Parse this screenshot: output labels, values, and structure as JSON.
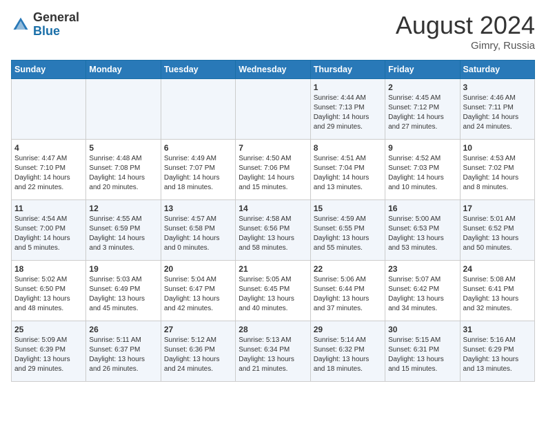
{
  "header": {
    "logo_general": "General",
    "logo_blue": "Blue",
    "month_year": "August 2024",
    "location": "Gimry, Russia"
  },
  "weekdays": [
    "Sunday",
    "Monday",
    "Tuesday",
    "Wednesday",
    "Thursday",
    "Friday",
    "Saturday"
  ],
  "weeks": [
    [
      {
        "day": "",
        "info": ""
      },
      {
        "day": "",
        "info": ""
      },
      {
        "day": "",
        "info": ""
      },
      {
        "day": "",
        "info": ""
      },
      {
        "day": "1",
        "info": "Sunrise: 4:44 AM\nSunset: 7:13 PM\nDaylight: 14 hours\nand 29 minutes."
      },
      {
        "day": "2",
        "info": "Sunrise: 4:45 AM\nSunset: 7:12 PM\nDaylight: 14 hours\nand 27 minutes."
      },
      {
        "day": "3",
        "info": "Sunrise: 4:46 AM\nSunset: 7:11 PM\nDaylight: 14 hours\nand 24 minutes."
      }
    ],
    [
      {
        "day": "4",
        "info": "Sunrise: 4:47 AM\nSunset: 7:10 PM\nDaylight: 14 hours\nand 22 minutes."
      },
      {
        "day": "5",
        "info": "Sunrise: 4:48 AM\nSunset: 7:08 PM\nDaylight: 14 hours\nand 20 minutes."
      },
      {
        "day": "6",
        "info": "Sunrise: 4:49 AM\nSunset: 7:07 PM\nDaylight: 14 hours\nand 18 minutes."
      },
      {
        "day": "7",
        "info": "Sunrise: 4:50 AM\nSunset: 7:06 PM\nDaylight: 14 hours\nand 15 minutes."
      },
      {
        "day": "8",
        "info": "Sunrise: 4:51 AM\nSunset: 7:04 PM\nDaylight: 14 hours\nand 13 minutes."
      },
      {
        "day": "9",
        "info": "Sunrise: 4:52 AM\nSunset: 7:03 PM\nDaylight: 14 hours\nand 10 minutes."
      },
      {
        "day": "10",
        "info": "Sunrise: 4:53 AM\nSunset: 7:02 PM\nDaylight: 14 hours\nand 8 minutes."
      }
    ],
    [
      {
        "day": "11",
        "info": "Sunrise: 4:54 AM\nSunset: 7:00 PM\nDaylight: 14 hours\nand 5 minutes."
      },
      {
        "day": "12",
        "info": "Sunrise: 4:55 AM\nSunset: 6:59 PM\nDaylight: 14 hours\nand 3 minutes."
      },
      {
        "day": "13",
        "info": "Sunrise: 4:57 AM\nSunset: 6:58 PM\nDaylight: 14 hours\nand 0 minutes."
      },
      {
        "day": "14",
        "info": "Sunrise: 4:58 AM\nSunset: 6:56 PM\nDaylight: 13 hours\nand 58 minutes."
      },
      {
        "day": "15",
        "info": "Sunrise: 4:59 AM\nSunset: 6:55 PM\nDaylight: 13 hours\nand 55 minutes."
      },
      {
        "day": "16",
        "info": "Sunrise: 5:00 AM\nSunset: 6:53 PM\nDaylight: 13 hours\nand 53 minutes."
      },
      {
        "day": "17",
        "info": "Sunrise: 5:01 AM\nSunset: 6:52 PM\nDaylight: 13 hours\nand 50 minutes."
      }
    ],
    [
      {
        "day": "18",
        "info": "Sunrise: 5:02 AM\nSunset: 6:50 PM\nDaylight: 13 hours\nand 48 minutes."
      },
      {
        "day": "19",
        "info": "Sunrise: 5:03 AM\nSunset: 6:49 PM\nDaylight: 13 hours\nand 45 minutes."
      },
      {
        "day": "20",
        "info": "Sunrise: 5:04 AM\nSunset: 6:47 PM\nDaylight: 13 hours\nand 42 minutes."
      },
      {
        "day": "21",
        "info": "Sunrise: 5:05 AM\nSunset: 6:45 PM\nDaylight: 13 hours\nand 40 minutes."
      },
      {
        "day": "22",
        "info": "Sunrise: 5:06 AM\nSunset: 6:44 PM\nDaylight: 13 hours\nand 37 minutes."
      },
      {
        "day": "23",
        "info": "Sunrise: 5:07 AM\nSunset: 6:42 PM\nDaylight: 13 hours\nand 34 minutes."
      },
      {
        "day": "24",
        "info": "Sunrise: 5:08 AM\nSunset: 6:41 PM\nDaylight: 13 hours\nand 32 minutes."
      }
    ],
    [
      {
        "day": "25",
        "info": "Sunrise: 5:09 AM\nSunset: 6:39 PM\nDaylight: 13 hours\nand 29 minutes."
      },
      {
        "day": "26",
        "info": "Sunrise: 5:11 AM\nSunset: 6:37 PM\nDaylight: 13 hours\nand 26 minutes."
      },
      {
        "day": "27",
        "info": "Sunrise: 5:12 AM\nSunset: 6:36 PM\nDaylight: 13 hours\nand 24 minutes."
      },
      {
        "day": "28",
        "info": "Sunrise: 5:13 AM\nSunset: 6:34 PM\nDaylight: 13 hours\nand 21 minutes."
      },
      {
        "day": "29",
        "info": "Sunrise: 5:14 AM\nSunset: 6:32 PM\nDaylight: 13 hours\nand 18 minutes."
      },
      {
        "day": "30",
        "info": "Sunrise: 5:15 AM\nSunset: 6:31 PM\nDaylight: 13 hours\nand 15 minutes."
      },
      {
        "day": "31",
        "info": "Sunrise: 5:16 AM\nSunset: 6:29 PM\nDaylight: 13 hours\nand 13 minutes."
      }
    ]
  ]
}
